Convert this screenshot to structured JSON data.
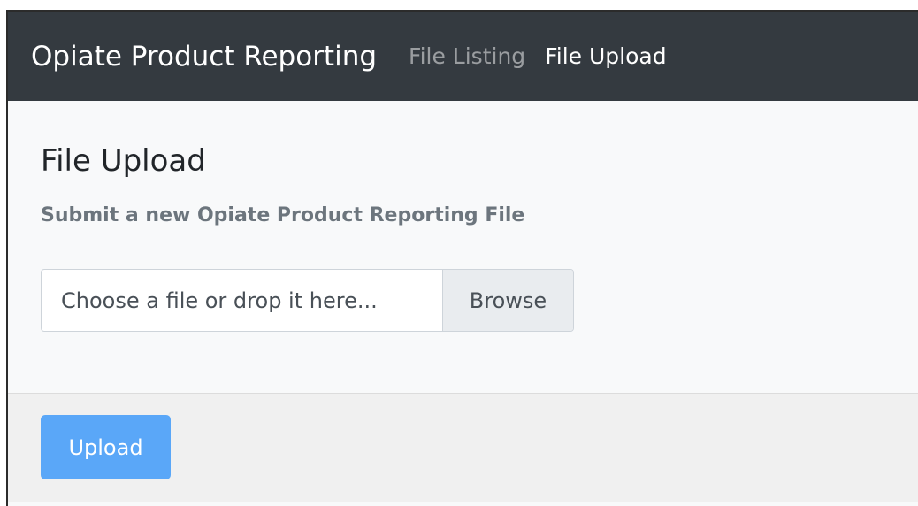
{
  "navbar": {
    "brand": "Opiate Product Reporting",
    "links": [
      {
        "label": "File Listing",
        "active": false
      },
      {
        "label": "File Upload",
        "active": true
      }
    ]
  },
  "page": {
    "title": "File Upload",
    "subtitle": "Submit a new Opiate Product Reporting File"
  },
  "file_input": {
    "placeholder": "Choose a file or drop it here...",
    "browse_label": "Browse"
  },
  "footer": {
    "upload_label": "Upload"
  },
  "colors": {
    "navbar_bg": "#343a40",
    "upload_button": "#5aa7f8",
    "subtitle": "#6c757d"
  }
}
